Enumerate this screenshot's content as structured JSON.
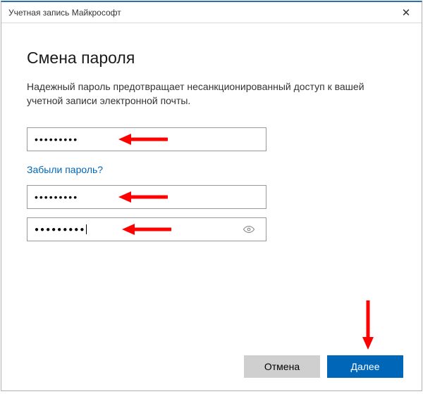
{
  "window": {
    "title": "Учетная запись Майкрософт"
  },
  "heading": "Смена пароля",
  "description": "Надежный пароль предотвращает несанкционированный доступ к вашей учетной записи электронной почты.",
  "fields": {
    "current_password": {
      "value": "●●●●●●●●●"
    },
    "new_password": {
      "value": "●●●●●●●●●"
    },
    "confirm_password": {
      "value": "●●●●●●●●●"
    }
  },
  "links": {
    "forgot": "Забыли пароль?"
  },
  "buttons": {
    "cancel": "Отмена",
    "next": "Далее"
  },
  "icons": {
    "close": "✕"
  },
  "colors": {
    "accent": "#0067b8",
    "arrow": "#ff0000"
  }
}
